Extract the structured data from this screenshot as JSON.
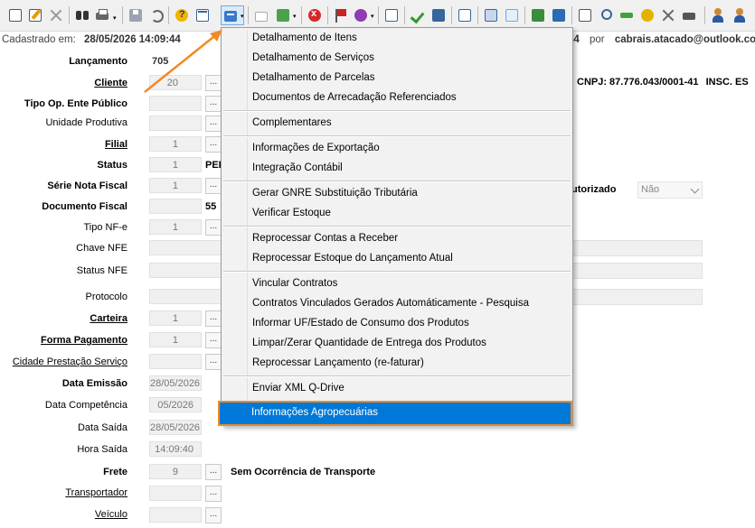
{
  "header": {
    "cadastrado_label": "Cadastrado em:",
    "cadastrado_value": "28/05/2026 14:09:44",
    "right_fragment": "44",
    "por_label": "por",
    "user_email": "cabrais.atacado@outlook.com"
  },
  "form": {
    "lancamento": {
      "label": "Lançamento",
      "value": "705"
    },
    "cliente": {
      "label": "Cliente",
      "value": "20"
    },
    "tipo_op": {
      "label": "Tipo Op. Ente Público",
      "value": ""
    },
    "unidade": {
      "label": "Unidade Produtiva",
      "value": ""
    },
    "filial": {
      "label": "Filial",
      "value": "1"
    },
    "status": {
      "label": "Status",
      "value": "1",
      "desc": "PEI"
    },
    "serie": {
      "label": "Série Nota Fiscal",
      "value": "1"
    },
    "documento": {
      "label": "Documento Fiscal",
      "value": "",
      "desc": "55"
    },
    "tipo_nfe": {
      "label": "Tipo NF-e",
      "value": "1"
    },
    "chave": {
      "label": "Chave NFE"
    },
    "status_nfe": {
      "label": "Status NFE"
    },
    "protocolo": {
      "label": "Protocolo"
    },
    "carteira": {
      "label": "Carteira",
      "value": "1"
    },
    "forma_pag": {
      "label": "Forma Pagamento",
      "value": "1"
    },
    "cidade": {
      "label": "Cidade Prestação Serviço",
      "value": ""
    },
    "data_emissao": {
      "label": "Data Emissão",
      "value": "28/05/2026"
    },
    "data_comp": {
      "label": "Data Competência",
      "value": "05/2026"
    },
    "data_saida": {
      "label": "Data Saída",
      "value": "28/05/2026"
    },
    "hora_saida": {
      "label": "Hora Saída",
      "value": "14:09:40"
    },
    "frete": {
      "label": "Frete",
      "value": "9",
      "desc": "Sem Ocorrência de Transporte"
    },
    "transportador": {
      "label": "Transportador",
      "value": ""
    },
    "veiculo": {
      "label": "Veículo",
      "value": ""
    }
  },
  "right": {
    "cnpj": "CNPJ: 87.776.043/0001-41",
    "insc": "INSC. ES",
    "autorizado_label": "utorizado",
    "autorizado_value": "Não"
  },
  "dots_label": "...",
  "menu": {
    "items": [
      "Detalhamento de Itens",
      "Detalhamento de Serviços",
      "Detalhamento de Parcelas",
      "Documentos de Arrecadação Referenciados",
      "Complementares",
      "Informações de Exportação",
      "Integração Contábil",
      "Gerar GNRE Substituição Tributária",
      "Verificar Estoque",
      "Reprocessar Contas a Receber",
      "Reprocessar Estoque do Lançamento Atual",
      "Vincular Contratos",
      "Contratos Vinculados Gerados Automáticamente - Pesquisa",
      "Informar UF/Estado de Consumo dos Produtos",
      "Limpar/Zerar Quantidade de Entrega dos Produtos",
      "Reprocessar Lançamento (re-faturar)",
      "Enviar XML Q-Drive"
    ],
    "highlighted": "Informações Agropecuárias"
  },
  "toolbar_icons": [
    "new-icon",
    "edit-icon",
    "delete-icon",
    "binoculars-icon",
    "print-icon",
    "save-icon",
    "undo-icon",
    "help-icon",
    "form-icon",
    "menu-dropdown-icon",
    "blank-icon",
    "export-icon",
    "stop-icon",
    "flag-icon",
    "reports-icon",
    "list-icon",
    "check-icon",
    "copy-icon",
    "document-icon",
    "sync-icon",
    "transfer-icon",
    "chart-icon",
    "image-icon",
    "paste-icon",
    "zoom-icon",
    "money-icon",
    "coins-icon",
    "tools-icon",
    "keyboard-icon",
    "user-icon",
    "users-icon"
  ],
  "colors": {
    "accent": "#0078d7",
    "highlight_outline": "#f08a24",
    "toolbar_bg": "#f0f0f0"
  }
}
